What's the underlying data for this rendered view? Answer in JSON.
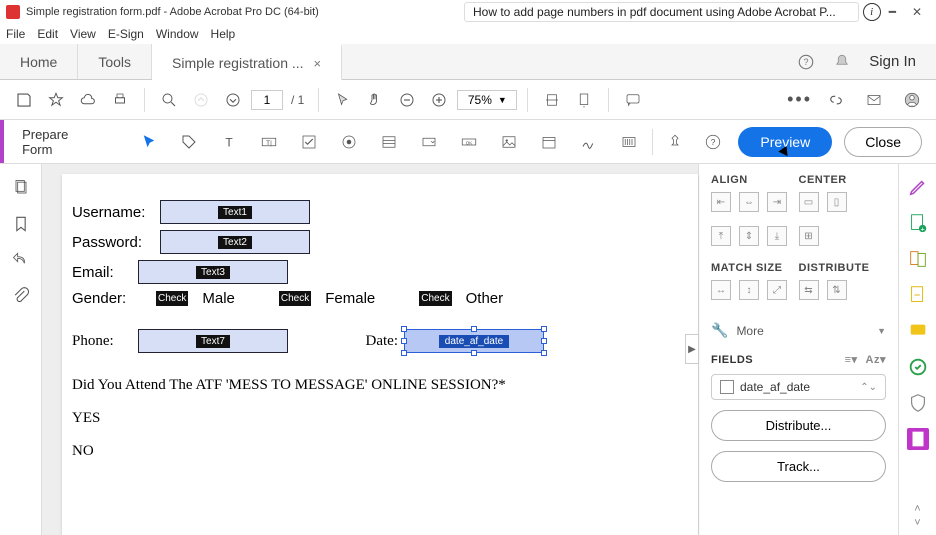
{
  "title": "Simple registration form.pdf - Adobe Acrobat Pro DC (64-bit)",
  "banner": "How to add page numbers in pdf document using Adobe Acrobat P...",
  "menu": {
    "file": "File",
    "edit": "Edit",
    "view": "View",
    "esign": "E-Sign",
    "window": "Window",
    "help": "Help"
  },
  "tabs": {
    "home": "Home",
    "tools": "Tools",
    "doc": "Simple registration ...",
    "signin": "Sign In"
  },
  "toolbar": {
    "page_current": "1",
    "page_total": "/  1",
    "zoom": "75%"
  },
  "prep": {
    "label": "Prepare Form",
    "preview": "Preview",
    "close": "Close"
  },
  "form": {
    "username_label": "Username:",
    "username_field": "Text1",
    "password_label": "Password:",
    "password_field": "Text2",
    "email_label": "Email:",
    "email_field": "Text3",
    "gender_label": "Gender:",
    "check": "Check",
    "male": "Male",
    "female": "Female",
    "other": "Other",
    "phone_label": "Phone:",
    "phone_field": "Text7",
    "date_label": "Date:",
    "date_field": "date_af_date",
    "question": "Did You Attend The ATF 'MESS TO MESSAGE' ONLINE SESSION?*",
    "yes": "YES",
    "no": "NO"
  },
  "rpanel": {
    "align": "ALIGN",
    "center": "CENTER",
    "match": "MATCH SIZE",
    "distribute": "DISTRIBUTE",
    "more": "More",
    "fields": "FIELDS",
    "field_item": "date_af_date",
    "distribute_btn": "Distribute...",
    "track_btn": "Track..."
  }
}
